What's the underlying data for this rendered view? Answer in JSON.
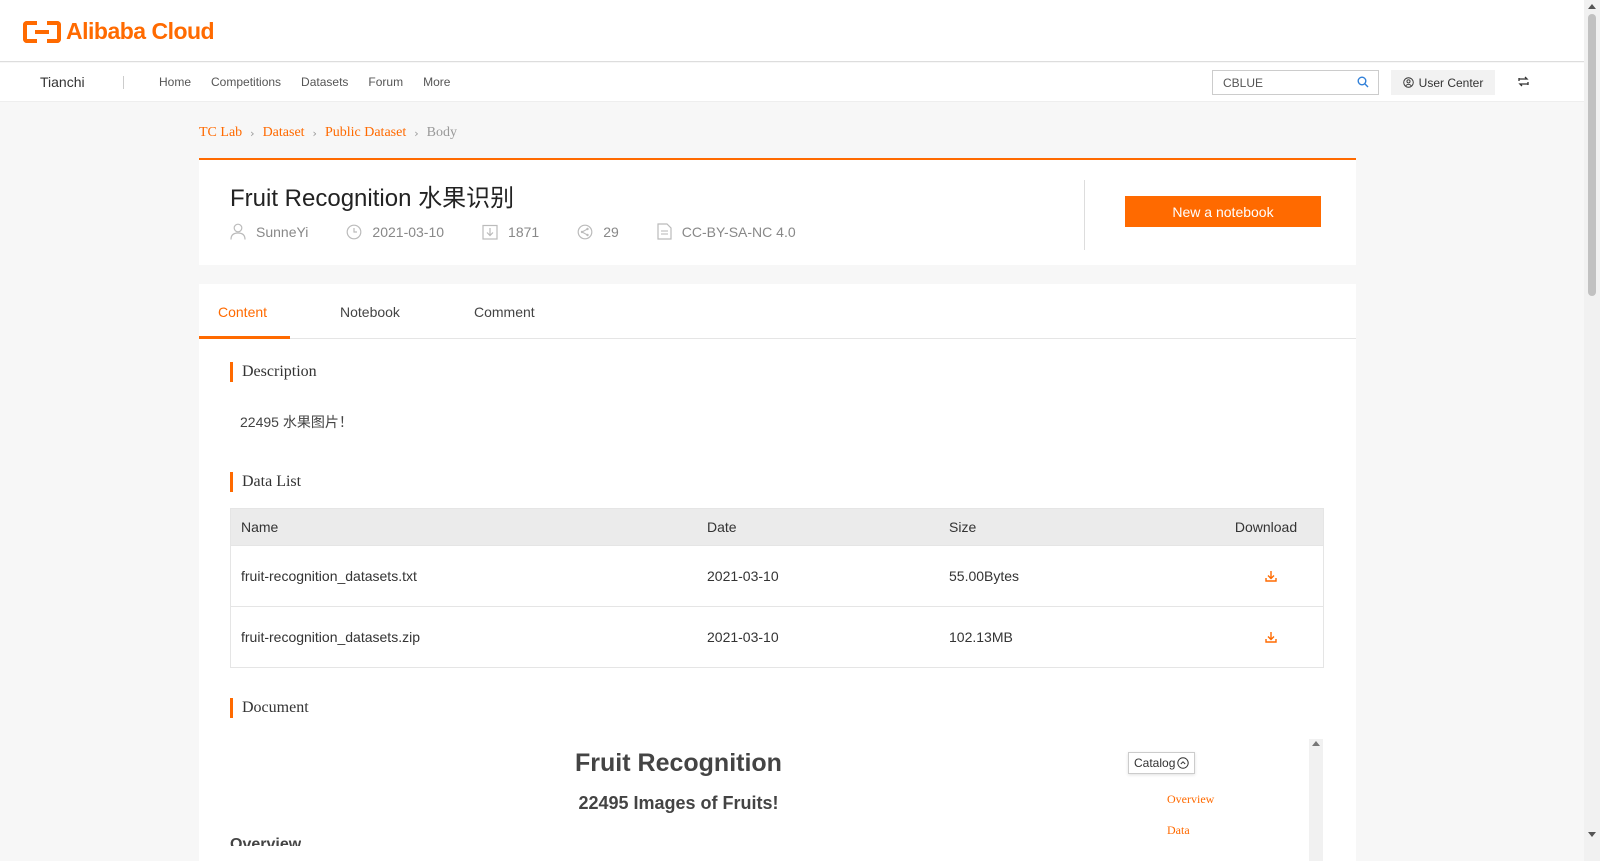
{
  "header": {
    "logo_text": "Alibaba Cloud"
  },
  "nav": {
    "brand": "Tianchi",
    "links": [
      "Home",
      "Competitions",
      "Datasets",
      "Forum",
      "More"
    ],
    "search_value": "CBLUE",
    "user_center": "User Center"
  },
  "breadcrumb": [
    "TC Lab",
    "Dataset",
    "Public Dataset",
    "Body"
  ],
  "dataset": {
    "title": "Fruit Recognition 水果识别",
    "author": "SunneYi",
    "date": "2021-03-10",
    "downloads": "1871",
    "shares": "29",
    "license": "CC-BY-SA-NC 4.0",
    "new_notebook": "New a notebook"
  },
  "tabs": [
    "Content",
    "Notebook",
    "Comment"
  ],
  "sections": {
    "description_title": "Description",
    "description_text": "22495 水果图片！",
    "datalist_title": "Data List",
    "document_title": "Document"
  },
  "table": {
    "headers": [
      "Name",
      "Date",
      "Size",
      "Download"
    ],
    "rows": [
      {
        "name": "fruit-recognition_datasets.txt",
        "date": "2021-03-10",
        "size": "55.00Bytes"
      },
      {
        "name": "fruit-recognition_datasets.zip",
        "date": "2021-03-10",
        "size": "102.13MB"
      }
    ]
  },
  "document": {
    "h1": "Fruit Recognition",
    "h2": "22495 Images of Fruits!",
    "cut_heading": "Overview",
    "catalog_label": "Catalog",
    "catalog_items": [
      "Overview",
      "Data"
    ]
  },
  "colors": {
    "accent": "#ff6a00"
  }
}
